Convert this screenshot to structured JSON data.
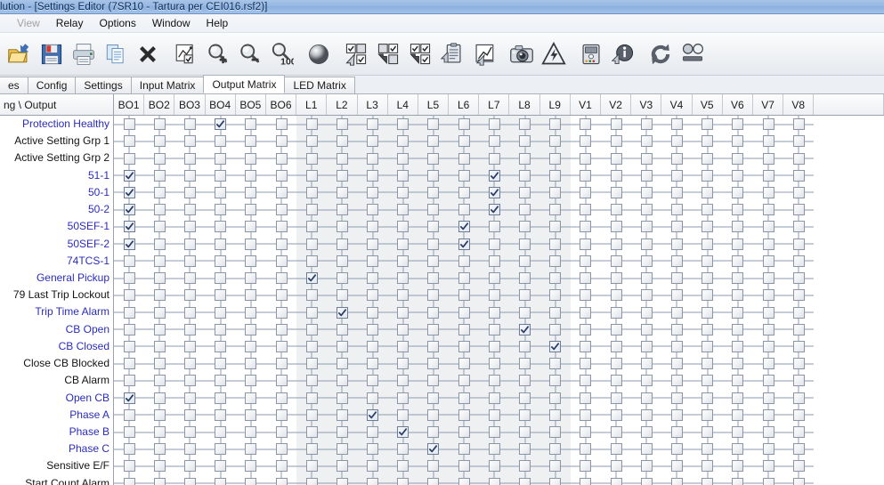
{
  "window": {
    "title": "lution - [Settings Editor (7SR10 - Tartura per CEI016.rsf2)]"
  },
  "menu": {
    "items": [
      {
        "label": "View",
        "disabled": true
      },
      {
        "label": "Relay",
        "disabled": false
      },
      {
        "label": "Options",
        "disabled": false
      },
      {
        "label": "Window",
        "disabled": false
      },
      {
        "label": "Help",
        "disabled": false
      }
    ]
  },
  "toolbar": {
    "buttons": [
      {
        "name": "open-folder-icon",
        "title": "Open"
      },
      {
        "name": "save-disk-icon",
        "title": "Save"
      },
      {
        "name": "print-icon",
        "title": "Print"
      },
      {
        "name": "copy-pages-icon",
        "title": "Copy"
      },
      {
        "name": "close-x-icon",
        "title": "Close"
      },
      {
        "name": "edit-chart-checkbox-icon",
        "title": "Edit"
      },
      {
        "name": "zoom-in-icon",
        "title": "Zoom In"
      },
      {
        "name": "zoom-out-icon",
        "title": "Zoom Out"
      },
      {
        "name": "zoom-100-icon",
        "title": "Zoom 100"
      },
      {
        "name": "sphere-icon",
        "title": "Sphere"
      },
      {
        "name": "copy-left-matrix-icon",
        "title": "Copy Left"
      },
      {
        "name": "copy-right-matrix-icon",
        "title": "Copy Right"
      },
      {
        "name": "copy-all-matrix-icon",
        "title": "Copy All"
      },
      {
        "name": "clipboard-send-icon",
        "title": "Clipboard"
      },
      {
        "name": "send-chart-icon",
        "title": "Send Chart"
      },
      {
        "name": "camera-icon",
        "title": "Snapshot"
      },
      {
        "name": "hazard-warning-icon",
        "title": "Warning"
      },
      {
        "name": "relay-device-icon",
        "title": "Device"
      },
      {
        "name": "info-send-icon",
        "title": "Info"
      },
      {
        "name": "refresh-icon",
        "title": "Refresh"
      },
      {
        "name": "led-indicators-icon",
        "title": "LEDs"
      }
    ]
  },
  "tabs": {
    "items": [
      {
        "label": "es",
        "active": false
      },
      {
        "label": "Config",
        "active": false
      },
      {
        "label": "Settings",
        "active": false
      },
      {
        "label": "Input Matrix",
        "active": false
      },
      {
        "label": "Output Matrix",
        "active": true
      },
      {
        "label": "LED Matrix",
        "active": false
      }
    ]
  },
  "matrix": {
    "corner_label": "ng \\ Output",
    "columns": [
      "BO1",
      "BO2",
      "BO3",
      "BO4",
      "BO5",
      "BO6",
      "L1",
      "L2",
      "L3",
      "L4",
      "L5",
      "L6",
      "L7",
      "L8",
      "L9",
      "V1",
      "V2",
      "V3",
      "V4",
      "V5",
      "V6",
      "V7",
      "V8"
    ],
    "shaded_column_range": [
      6,
      14
    ],
    "rows": [
      {
        "label": "Protection Healthy",
        "color": "blue",
        "checked": [
          "BO4"
        ]
      },
      {
        "label": "Active Setting Grp 1",
        "color": "black",
        "checked": []
      },
      {
        "label": "Active Setting Grp 2",
        "color": "black",
        "checked": []
      },
      {
        "label": "51-1",
        "color": "blue",
        "checked": [
          "BO1",
          "L7"
        ]
      },
      {
        "label": "50-1",
        "color": "blue",
        "checked": [
          "BO1",
          "L7"
        ]
      },
      {
        "label": "50-2",
        "color": "blue",
        "checked": [
          "BO1",
          "L7"
        ]
      },
      {
        "label": "50SEF-1",
        "color": "blue",
        "checked": [
          "BO1",
          "L6"
        ]
      },
      {
        "label": "50SEF-2",
        "color": "blue",
        "checked": [
          "BO1",
          "L6"
        ]
      },
      {
        "label": "74TCS-1",
        "color": "blue",
        "checked": []
      },
      {
        "label": "General Pickup",
        "color": "blue",
        "checked": [
          "L1"
        ]
      },
      {
        "label": "79 Last Trip Lockout",
        "color": "black",
        "checked": []
      },
      {
        "label": "Trip Time Alarm",
        "color": "blue",
        "checked": [
          "L2"
        ]
      },
      {
        "label": "CB Open",
        "color": "blue",
        "checked": [
          "L8"
        ]
      },
      {
        "label": "CB Closed",
        "color": "blue",
        "checked": [
          "L9"
        ]
      },
      {
        "label": "Close CB Blocked",
        "color": "black",
        "checked": []
      },
      {
        "label": "CB Alarm",
        "color": "black",
        "checked": []
      },
      {
        "label": "Open CB",
        "color": "blue",
        "checked": [
          "BO1"
        ]
      },
      {
        "label": "Phase A",
        "color": "blue",
        "checked": [
          "L3"
        ]
      },
      {
        "label": "Phase B",
        "color": "blue",
        "checked": [
          "L4"
        ]
      },
      {
        "label": "Phase C",
        "color": "blue",
        "checked": [
          "L5"
        ]
      },
      {
        "label": "Sensitive E/F",
        "color": "black",
        "checked": []
      },
      {
        "label": "Start Count Alarm",
        "color": "black",
        "checked": []
      }
    ]
  }
}
